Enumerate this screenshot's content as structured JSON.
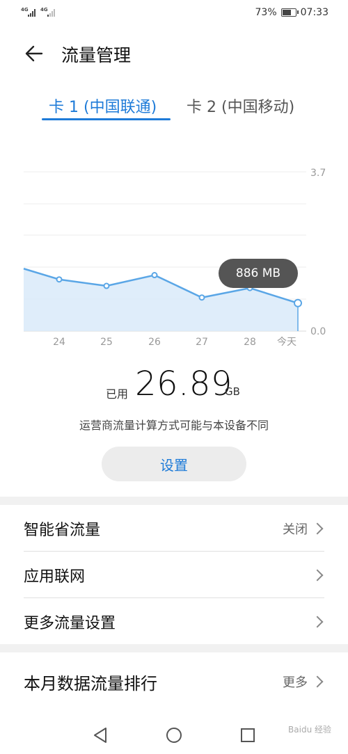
{
  "status_bar": {
    "sim1_network": "4G",
    "sim2_network": "4G",
    "battery_percent": "73%",
    "battery_level": 0.73,
    "time": "07:33"
  },
  "header": {
    "title": "流量管理"
  },
  "tabs": [
    {
      "label": "卡 1 (中国联通)",
      "active": true
    },
    {
      "label": "卡 2 (中国移动)",
      "active": false
    }
  ],
  "chart_data": {
    "type": "area",
    "x": [
      "",
      "24",
      "25",
      "26",
      "27",
      "28",
      "今天"
    ],
    "values": [
      1.45,
      1.2,
      1.05,
      1.3,
      0.78,
      1.0,
      0.65
    ],
    "y_tick_labels": [
      "3.7",
      "0.0"
    ],
    "ylim": [
      0,
      3.7
    ],
    "grid": true,
    "tooltip": "886 MB",
    "line_color": "#5aa6e6",
    "fill_color": "#dcebfa"
  },
  "usage": {
    "label": "已用",
    "value": "26.89",
    "unit": "GB",
    "note": "运营商流量计算方式可能与本设备不同"
  },
  "settings_button": "设置",
  "menu": [
    {
      "label": "智能省流量",
      "value": "关闭"
    },
    {
      "label": "应用联网",
      "value": ""
    },
    {
      "label": "更多流量设置",
      "value": ""
    }
  ],
  "ranking": {
    "label": "本月数据流量排行",
    "value": "更多"
  },
  "watermark": "Baidu 经验",
  "colors": {
    "accent": "#1e7bd8"
  }
}
